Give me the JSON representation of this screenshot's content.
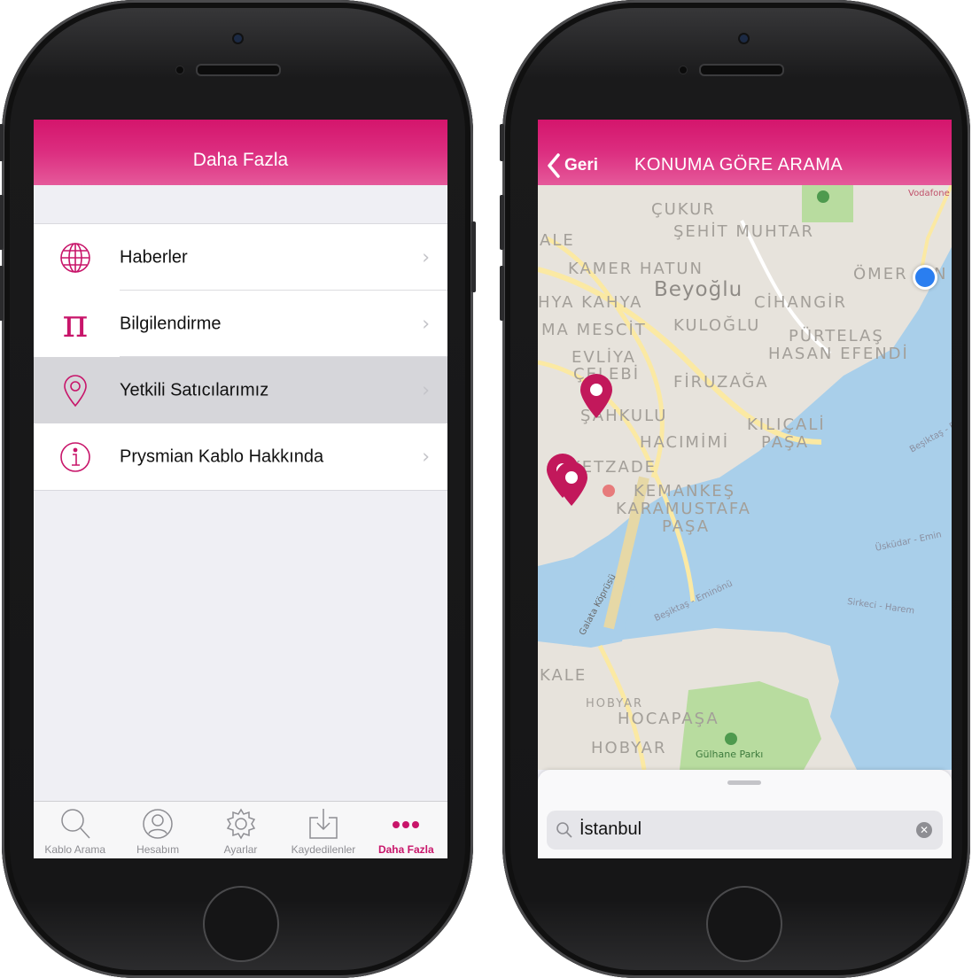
{
  "left_screen": {
    "title": "Daha Fazla",
    "items": [
      {
        "label": "Haberler",
        "icon": "globe-icon"
      },
      {
        "label": "Bilgilendirme",
        "icon": "pi-icon"
      },
      {
        "label": "Yetkili Satıcılarımız",
        "icon": "location-pin-icon",
        "highlighted": true
      },
      {
        "label": "Prysmian Kablo Hakkında",
        "icon": "info-icon"
      }
    ],
    "tabs": [
      {
        "label": "Kablo Arama",
        "icon": "search-icon"
      },
      {
        "label": "Hesabım",
        "icon": "user-icon"
      },
      {
        "label": "Ayarlar",
        "icon": "gear-icon"
      },
      {
        "label": "Kaydedilenler",
        "icon": "download-icon"
      },
      {
        "label": "Daha Fazla",
        "icon": "more-icon",
        "active": true
      }
    ]
  },
  "right_screen": {
    "back_label": "Geri",
    "title": "KONUMA GÖRE ARAMA",
    "map_labels": {
      "cukur": "ÇUKUR",
      "sehit_muhtar": "ŞEHİT MUHTAR",
      "ale": "ALE",
      "kamer_hatun": "KAMER HATUN",
      "beyoglu": "Beyoğlu",
      "omer": "ÖMER",
      "n": "N",
      "hya_kahya": "HYA KAHYA",
      "cihangir": "CİHANGİR",
      "ma_mescit": "MA MESCİT",
      "kuloglu": "KULOĞLU",
      "purtelas": "PÜRTELAŞ",
      "hasan_efendi": "HASAN EFENDİ",
      "evliya": "EVLİYA",
      "celebi": "ÇELEBİ",
      "firuzaga": "FİRUZAĞA",
      "sahkulu": "ŞAHKULU",
      "kilicali": "KILIÇALİ",
      "pasa1": "PAŞA",
      "hacimimi": "HACIMİMİ",
      "ketzade": "KETZADE",
      "kemankes": "KEMANKEŞ",
      "karamustafa": "KARAMUSTAFA",
      "pasa2": "PAŞA",
      "kale": "KALE",
      "hobyar1": "HOBYAR",
      "hocapasa": "HOCAPAŞA",
      "hobyar2": "HOBYAR",
      "gulhane": "Gülhane Parkı",
      "vodafone": "Vodafone",
      "galata": "Galata Köprüsü",
      "besiktas_eminonu": "Beşiktaş - Eminönü",
      "uskudar_eminonu": "Üsküdar - Emin",
      "sirkeci_harem": "Sirkeci - Harem",
      "besiktas": "Beşiktaş - E"
    },
    "search_value": "İstanbul"
  },
  "colors": {
    "brand": "#d4156c",
    "water": "#a9cfea",
    "land": "#e7e3dc",
    "park": "#b8dc9f",
    "road": "#fbe9a3",
    "user_location": "#2a7ef0"
  }
}
